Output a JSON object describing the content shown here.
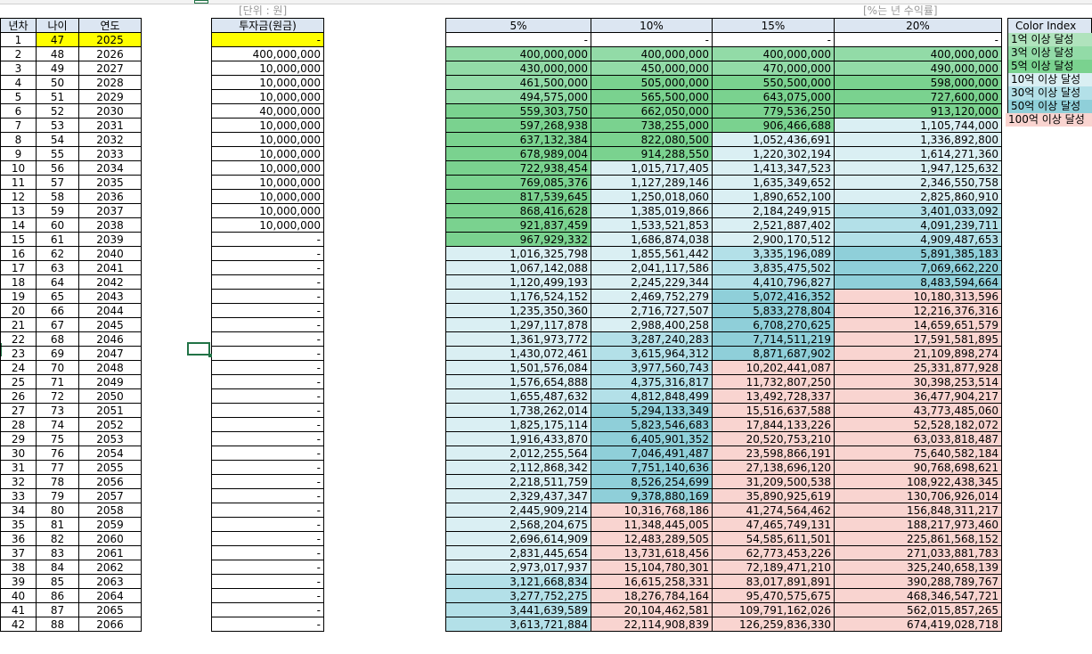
{
  "notes": {
    "unit": "[단위 : 원]",
    "rate": "[%는 년 수익률]"
  },
  "years_table": {
    "headers": [
      "년차",
      "나이",
      "연도"
    ],
    "rows": [
      [
        "1",
        "47",
        "2025"
      ],
      [
        "2",
        "48",
        "2026"
      ],
      [
        "3",
        "49",
        "2027"
      ],
      [
        "4",
        "50",
        "2028"
      ],
      [
        "5",
        "51",
        "2029"
      ],
      [
        "6",
        "52",
        "2030"
      ],
      [
        "7",
        "53",
        "2031"
      ],
      [
        "8",
        "54",
        "2032"
      ],
      [
        "9",
        "55",
        "2033"
      ],
      [
        "10",
        "56",
        "2034"
      ],
      [
        "11",
        "57",
        "2035"
      ],
      [
        "12",
        "58",
        "2036"
      ],
      [
        "13",
        "59",
        "2037"
      ],
      [
        "14",
        "60",
        "2038"
      ],
      [
        "15",
        "61",
        "2039"
      ],
      [
        "16",
        "62",
        "2040"
      ],
      [
        "17",
        "63",
        "2041"
      ],
      [
        "18",
        "64",
        "2042"
      ],
      [
        "19",
        "65",
        "2043"
      ],
      [
        "20",
        "66",
        "2044"
      ],
      [
        "21",
        "67",
        "2045"
      ],
      [
        "22",
        "68",
        "2046"
      ],
      [
        "23",
        "69",
        "2047"
      ],
      [
        "24",
        "70",
        "2048"
      ],
      [
        "25",
        "71",
        "2049"
      ],
      [
        "26",
        "72",
        "2050"
      ],
      [
        "27",
        "73",
        "2051"
      ],
      [
        "28",
        "74",
        "2052"
      ],
      [
        "29",
        "75",
        "2053"
      ],
      [
        "30",
        "76",
        "2054"
      ],
      [
        "31",
        "77",
        "2055"
      ],
      [
        "32",
        "78",
        "2056"
      ],
      [
        "33",
        "79",
        "2057"
      ],
      [
        "34",
        "80",
        "2058"
      ],
      [
        "35",
        "81",
        "2059"
      ],
      [
        "36",
        "82",
        "2060"
      ],
      [
        "37",
        "83",
        "2061"
      ],
      [
        "38",
        "84",
        "2062"
      ],
      [
        "39",
        "85",
        "2063"
      ],
      [
        "40",
        "86",
        "2064"
      ],
      [
        "41",
        "87",
        "2065"
      ],
      [
        "42",
        "88",
        "2066"
      ]
    ]
  },
  "invest_table": {
    "header": "투자금(원금)",
    "values": [
      "-",
      "400,000,000",
      "10,000,000",
      "10,000,000",
      "10,000,000",
      "40,000,000",
      "10,000,000",
      "10,000,000",
      "10,000,000",
      "10,000,000",
      "10,000,000",
      "10,000,000",
      "10,000,000",
      "10,000,000",
      "-",
      "-",
      "-",
      "-",
      "-",
      "-",
      "-",
      "-",
      "-",
      "-",
      "-",
      "-",
      "-",
      "-",
      "-",
      "-",
      "-",
      "-",
      "-",
      "-",
      "-",
      "-",
      "-",
      "-",
      "-",
      "-",
      "-",
      "-"
    ]
  },
  "returns_table": {
    "headers": [
      "5%",
      "10%",
      "15%",
      "20%"
    ],
    "rows": [
      [
        "-",
        "-",
        "-",
        "-"
      ],
      [
        "400,000,000",
        "400,000,000",
        "400,000,000",
        "400,000,000"
      ],
      [
        "430,000,000",
        "450,000,000",
        "470,000,000",
        "490,000,000"
      ],
      [
        "461,500,000",
        "505,000,000",
        "550,500,000",
        "598,000,000"
      ],
      [
        "494,575,000",
        "565,500,000",
        "643,075,000",
        "727,600,000"
      ],
      [
        "559,303,750",
        "662,050,000",
        "779,536,250",
        "913,120,000"
      ],
      [
        "597,268,938",
        "738,255,000",
        "906,466,688",
        "1,105,744,000"
      ],
      [
        "637,132,384",
        "822,080,500",
        "1,052,436,691",
        "1,336,892,800"
      ],
      [
        "678,989,004",
        "914,288,550",
        "1,220,302,194",
        "1,614,271,360"
      ],
      [
        "722,938,454",
        "1,015,717,405",
        "1,413,347,523",
        "1,947,125,632"
      ],
      [
        "769,085,376",
        "1,127,289,146",
        "1,635,349,652",
        "2,346,550,758"
      ],
      [
        "817,539,645",
        "1,250,018,060",
        "1,890,652,100",
        "2,825,860,910"
      ],
      [
        "868,416,628",
        "1,385,019,866",
        "2,184,249,915",
        "3,401,033,092"
      ],
      [
        "921,837,459",
        "1,533,521,853",
        "2,521,887,402",
        "4,091,239,711"
      ],
      [
        "967,929,332",
        "1,686,874,038",
        "2,900,170,512",
        "4,909,487,653"
      ],
      [
        "1,016,325,798",
        "1,855,561,442",
        "3,335,196,089",
        "5,891,385,183"
      ],
      [
        "1,067,142,088",
        "2,041,117,586",
        "3,835,475,502",
        "7,069,662,220"
      ],
      [
        "1,120,499,193",
        "2,245,229,344",
        "4,410,796,827",
        "8,483,594,664"
      ],
      [
        "1,176,524,152",
        "2,469,752,279",
        "5,072,416,352",
        "10,180,313,596"
      ],
      [
        "1,235,350,360",
        "2,716,727,507",
        "5,833,278,804",
        "12,216,376,316"
      ],
      [
        "1,297,117,878",
        "2,988,400,258",
        "6,708,270,625",
        "14,659,651,579"
      ],
      [
        "1,361,973,772",
        "3,287,240,283",
        "7,714,511,219",
        "17,591,581,895"
      ],
      [
        "1,430,072,461",
        "3,615,964,312",
        "8,871,687,902",
        "21,109,898,274"
      ],
      [
        "1,501,576,084",
        "3,977,560,743",
        "10,202,441,087",
        "25,331,877,928"
      ],
      [
        "1,576,654,888",
        "4,375,316,817",
        "11,732,807,250",
        "30,398,253,514"
      ],
      [
        "1,655,487,632",
        "4,812,848,499",
        "13,492,728,337",
        "36,477,904,217"
      ],
      [
        "1,738,262,014",
        "5,294,133,349",
        "15,516,637,588",
        "43,773,485,060"
      ],
      [
        "1,825,175,114",
        "5,823,546,683",
        "17,844,133,226",
        "52,528,182,072"
      ],
      [
        "1,916,433,870",
        "6,405,901,352",
        "20,520,753,210",
        "63,033,818,487"
      ],
      [
        "2,012,255,564",
        "7,046,491,487",
        "23,598,866,191",
        "75,640,582,184"
      ],
      [
        "2,112,868,342",
        "7,751,140,636",
        "27,138,696,120",
        "90,768,698,621"
      ],
      [
        "2,218,511,759",
        "8,526,254,699",
        "31,209,500,538",
        "108,922,438,345"
      ],
      [
        "2,329,437,347",
        "9,378,880,169",
        "35,890,925,619",
        "130,706,926,014"
      ],
      [
        "2,445,909,214",
        "10,316,768,186",
        "41,274,564,462",
        "156,848,311,217"
      ],
      [
        "2,568,204,675",
        "11,348,445,005",
        "47,465,749,131",
        "188,217,973,460"
      ],
      [
        "2,696,614,909",
        "12,483,289,505",
        "54,585,611,501",
        "225,861,568,152"
      ],
      [
        "2,831,445,654",
        "13,731,618,456",
        "62,773,453,226",
        "271,033,881,783"
      ],
      [
        "2,973,017,937",
        "15,104,780,301",
        "72,189,471,210",
        "325,240,658,139"
      ],
      [
        "3,121,668,834",
        "16,615,258,331",
        "83,017,891,891",
        "390,288,789,767"
      ],
      [
        "3,277,752,275",
        "18,276,784,164",
        "95,470,575,675",
        "468,346,547,721"
      ],
      [
        "3,441,639,589",
        "20,104,462,581",
        "109,791,162,026",
        "562,015,857,265"
      ],
      [
        "3,613,721,884",
        "22,114,908,839",
        "126,259,836,330",
        "674,419,028,718"
      ]
    ]
  },
  "color_index": {
    "title": "Color Index",
    "items": [
      "1억 이상 달성",
      "3억 이상 달성",
      "5억 이상 달성",
      "10억 이상 달성",
      "30억 이상 달성",
      "50억 이상 달성",
      "100억 이상 달성"
    ]
  },
  "colors": {
    "header": "#dce6f2",
    "highlight": "#ffff00",
    "over_100m": "#b0e3bd",
    "over_300m": "#92dba7",
    "over_500m": "#7ad28f",
    "over_1b": "#daeff3",
    "over_3b": "#b3e0e8",
    "over_5b": "#8fcfd9",
    "over_10b": "#f9d4d0",
    "selection": "#217346"
  }
}
